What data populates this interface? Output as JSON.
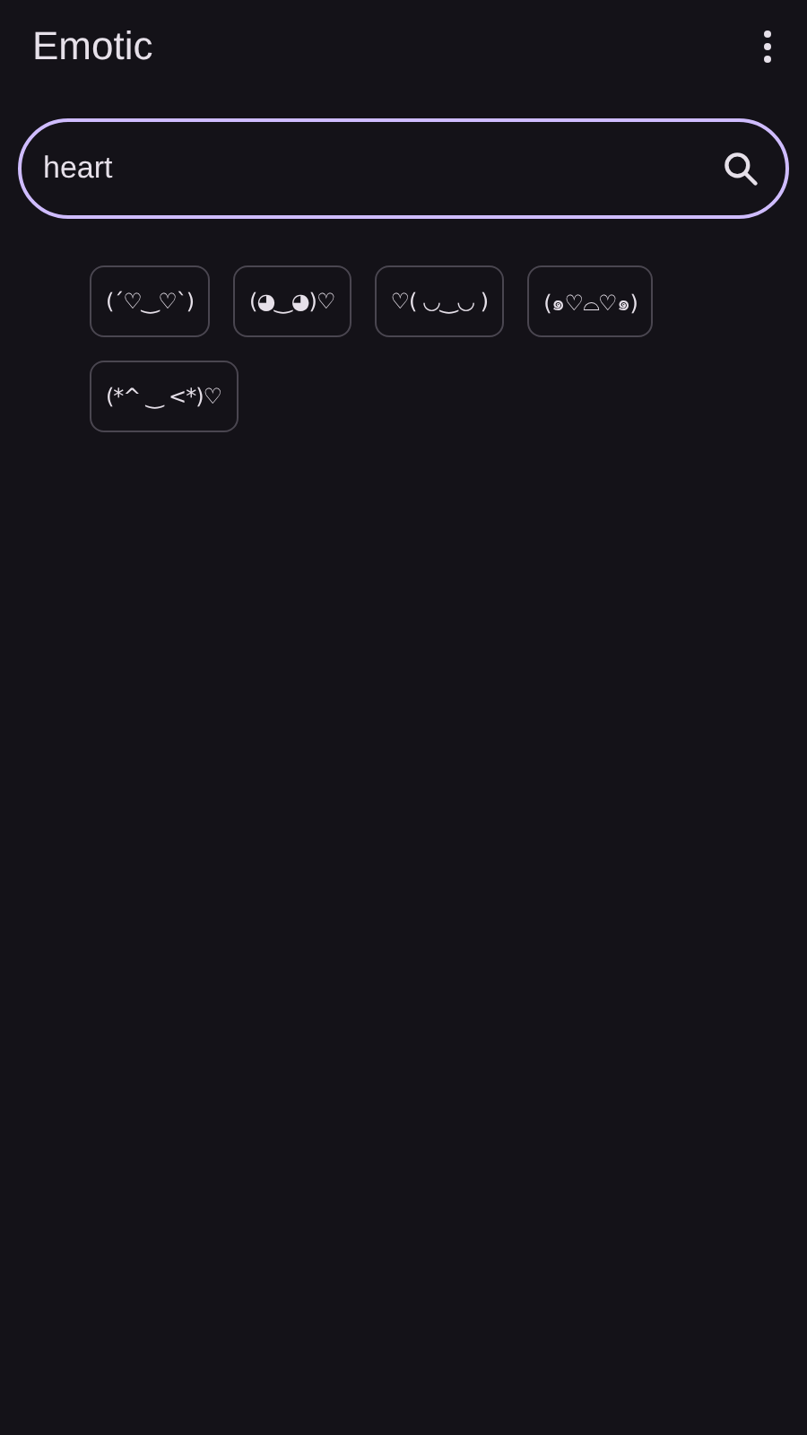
{
  "app_bar": {
    "title": "Emotic"
  },
  "search": {
    "value": "heart"
  },
  "emoticons": [
    {
      "text": "(´♡‿♡`)"
    },
    {
      "text": "(◕‿◕)♡"
    },
    {
      "text": "♡( ◡‿◡ )"
    },
    {
      "text": "(๑♡⌓♡๑)"
    },
    {
      "text": "(*^ ‿ <*)♡"
    }
  ]
}
